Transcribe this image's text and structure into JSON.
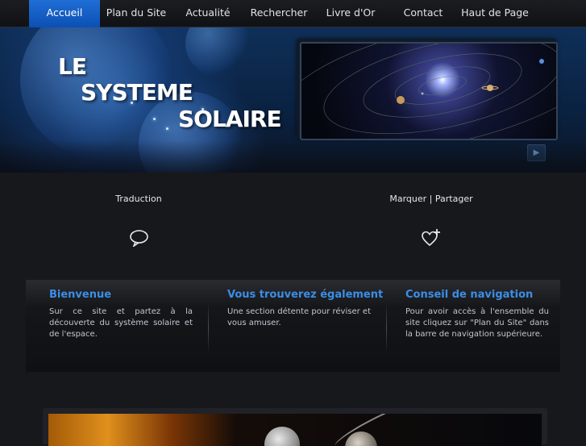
{
  "nav": {
    "items": [
      "Accueil",
      "Plan du Site",
      "Actualité",
      "Rechercher",
      "Livre d'Or",
      "Contact",
      "Haut de Page"
    ],
    "active": "Accueil"
  },
  "banner": {
    "title_lines": [
      "LE",
      "SYSTEME",
      "SOLAIRE"
    ]
  },
  "tools": {
    "translate_label": "Traduction",
    "translate_icon": "speech-bubble-icon",
    "share_label": "Marquer | Partager",
    "share_icon": "heart-plus-icon"
  },
  "info": {
    "columns": [
      {
        "title": "Bienvenue",
        "text": "Sur ce site et partez à la découverte du système solaire et de l'espace."
      },
      {
        "title": "Vous trouverez également",
        "text": "Une section détente pour réviser et vous amuser."
      },
      {
        "title": "Conseil de navigation",
        "text": "Pour avoir accès à l'ensemble du site cliquez sur \"Plan du Site\" dans la barre de navigation supérieure."
      }
    ]
  },
  "colors": {
    "nav_active": "#1565c8",
    "heading_blue": "#3b8ee6",
    "background": "#17181c"
  }
}
